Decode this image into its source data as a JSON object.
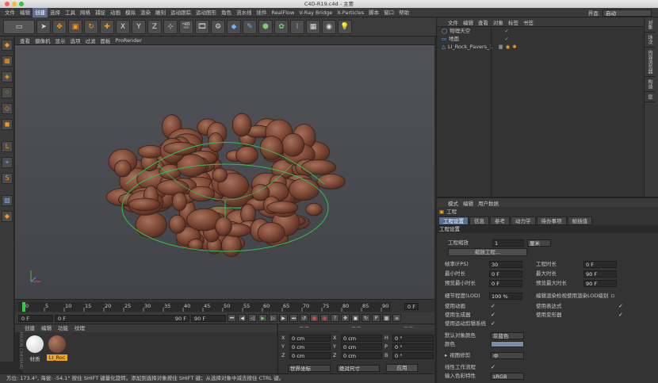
{
  "window": {
    "title": "C4D-R19.c4d - 主要"
  },
  "menu": {
    "items": [
      "文件",
      "编辑",
      "创建",
      "选择",
      "工具",
      "网格",
      "捕捉",
      "动画",
      "模拟",
      "渲染",
      "雕刻",
      "运动跟踪",
      "运动图形",
      "角色",
      "流水线",
      "插件",
      "RealFlow",
      "V-Ray Bridge",
      "X-Particles",
      "脚本",
      "窗口",
      "帮助"
    ],
    "active_index": 2,
    "interface_label": "界面:",
    "interface_value": "启动"
  },
  "toolbar": {
    "icons": [
      "undo-icon",
      "live-select-icon",
      "move-icon",
      "scale-icon",
      "rotate-icon",
      "add-icon",
      "x-axis-icon",
      "y-axis-icon",
      "z-axis-icon",
      "coord-icon",
      "render-view-icon",
      "render-picture-icon",
      "render-settings-icon",
      "cube-icon",
      "pen-icon",
      "subdivision-icon",
      "array-icon",
      "deformer-icon",
      "floor-icon",
      "camera-icon",
      "light-icon"
    ],
    "axis": [
      "X",
      "Y",
      "Z"
    ]
  },
  "viewport": {
    "menu": [
      "查看",
      "摄像机",
      "显示",
      "选项",
      "过滤",
      "面板",
      "ProRender"
    ]
  },
  "timeline": {
    "ticks": [
      "0",
      "5",
      "10",
      "15",
      "20",
      "25",
      "30",
      "35",
      "40",
      "45",
      "50",
      "55",
      "60",
      "65",
      "70",
      "75",
      "80",
      "85",
      "90"
    ],
    "current_frame": "0 F"
  },
  "transport": {
    "start": "0 F",
    "preview_start": "0 F",
    "preview_end": "90 F",
    "end": "90 F"
  },
  "materials": {
    "menu": [
      "创建",
      "编辑",
      "功能",
      "纹理"
    ],
    "items": [
      "材质",
      "LI_Roc"
    ]
  },
  "coords": {
    "rows": [
      {
        "a": "X",
        "v1": "0 cm",
        "b": "X",
        "v2": "0 cm",
        "c": "H",
        "v3": "0 °"
      },
      {
        "a": "Y",
        "v1": "0 cm",
        "b": "Y",
        "v2": "0 cm",
        "c": "P",
        "v3": "0 °"
      },
      {
        "a": "Z",
        "v1": "0 cm",
        "b": "Z",
        "v2": "0 cm",
        "c": "B",
        "v3": "0 °"
      }
    ],
    "mode": "世界坐标",
    "scale": "绝对尺寸",
    "apply": "应用"
  },
  "status": {
    "text": "方位: 173.4°, 海拔: -54.1° 按住 SHIFT 键量化旋转。添加到选择对象按住 SHIFT 键；从选择对象中减去按住 CTRL 键。"
  },
  "objects": {
    "menu": [
      "文件",
      "编辑",
      "查看",
      "对象",
      "标签",
      "书签"
    ],
    "rows": [
      {
        "name": "物理天空"
      },
      {
        "name": "地面"
      },
      {
        "name": "LI_Rock_Pavers_1"
      }
    ]
  },
  "right_tabs": [
    "对象",
    "场次",
    "内容浏览器",
    "构造",
    "层"
  ],
  "attributes": {
    "menu": [
      "模式",
      "编辑",
      "用户数据"
    ],
    "header": "工程",
    "tabs": [
      "工程设置",
      "信息",
      "参考",
      "动力学",
      "待办事项",
      "帧插值"
    ],
    "section": "工程设置",
    "scale_label": "工程缩放",
    "scale_value": "1",
    "scale_unit": "厘米",
    "scale_btn": "缩放工程...",
    "fps_label": "帧率(FPS)",
    "fps": "30",
    "proj_len_label": "工程时长",
    "proj_len": "0 F",
    "min_len_label": "最小时长",
    "min_len": "0 F",
    "max_len_label": "最大时长",
    "max_len": "90 F",
    "prev_min_label": "预览最小时长",
    "prev_min": "0 F",
    "prev_max_label": "预览最大时长",
    "prev_max": "90 F",
    "lod_label": "细节程度(LOD)",
    "lod": "100 %",
    "lod_check": "编辑渲染检视使用渲染LOD级别",
    "use_anim": "使用动画",
    "use_expr": "使用表达式",
    "use_gen": "使用生成器",
    "use_deform": "使用变形器",
    "use_motion": "使用运动剪辑系统",
    "default_color_label": "默认对象颜色",
    "default_color": "灰蓝色",
    "color_label": "颜色",
    "view_clip_label": "视图修剪",
    "view_clip": "中",
    "linear_label": "线性工作流程",
    "input_color_label": "输入色彩特性",
    "input_color": "sRGB"
  }
}
